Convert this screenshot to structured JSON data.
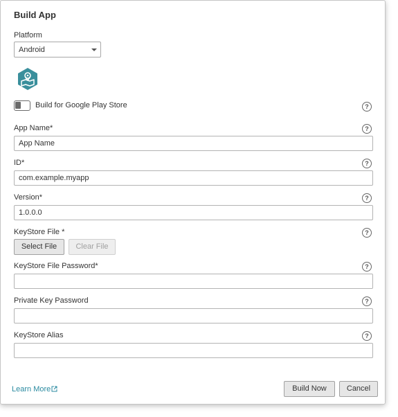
{
  "dialog": {
    "title": "Build App"
  },
  "platform": {
    "label": "Platform",
    "selected": "Android"
  },
  "app_icon": "map-pin-icon",
  "google_play": {
    "label": "Build for Google Play Store",
    "enabled": false
  },
  "fields": {
    "app_name": {
      "label": "App Name*",
      "value": "App Name"
    },
    "id": {
      "label": "ID*",
      "value": "com.example.myapp"
    },
    "version": {
      "label": "Version*",
      "value": "1.0.0.0"
    },
    "keystore_file": {
      "label": "KeyStore File *",
      "select_label": "Select File",
      "clear_label": "Clear File"
    },
    "keystore_password": {
      "label": "KeyStore File Password*",
      "value": ""
    },
    "private_key_password": {
      "label": "Private Key Password",
      "value": ""
    },
    "keystore_alias": {
      "label": "KeyStore Alias",
      "value": ""
    }
  },
  "help_glyph": "?",
  "footer": {
    "learn_more": "Learn More",
    "build_now": "Build Now",
    "cancel": "Cancel"
  },
  "colors": {
    "accent": "#2a8aa0",
    "icon_teal": "#3a8f9c"
  }
}
